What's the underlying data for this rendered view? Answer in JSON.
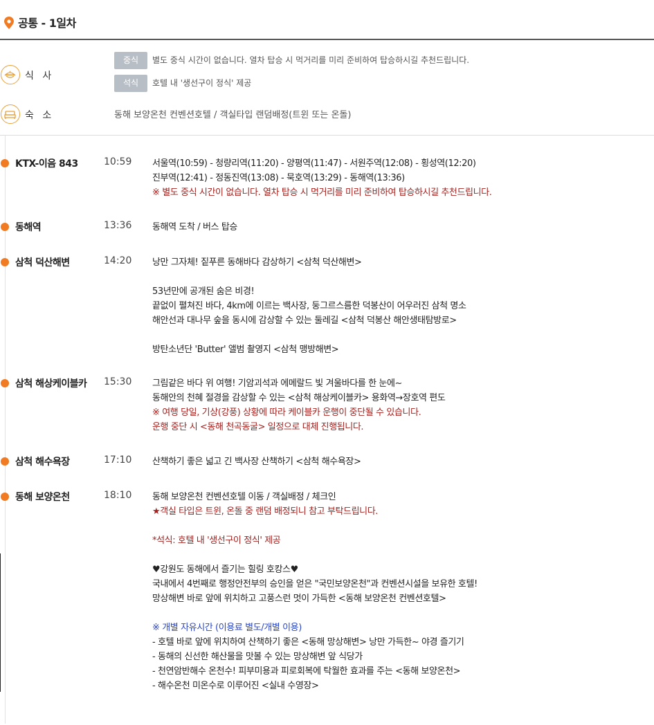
{
  "header": {
    "title": "공통 - 1일차",
    "accent": "#f07b22"
  },
  "info": {
    "meal_label": "식 사",
    "lunch_tag": "중식",
    "lunch_text": "별도 중식 시간이 없습니다. 열차 탑승 시 먹거리를 미리 준비하여 탑승하시길 추천드립니다.",
    "dinner_tag": "석식",
    "dinner_text": "호텔 내 '생선구이 정식' 제공",
    "lodging_label": "숙 소",
    "lodging_text": "동해 보양온천 컨벤션호텔 / 객실타입 랜덤배정(트윈 또는 온돌)"
  },
  "schedule": [
    {
      "place": "KTX-이음 843",
      "time": "10:59",
      "lines": [
        "서울역(10:59) - 청량리역(11:20) - 양평역(11:47) - 서원주역(12:08) - 횡성역(12:20)",
        "진부역(12:41) - 정동진역(13:08) - 묵호역(13:29) - 동해역(13:36)",
        "※ 별도 중식 시간이 없습니다. 열차 탑승 시 먹거리를 미리 준비하여 탑승하시길 추천드립니다."
      ]
    },
    {
      "place": "동해역",
      "time": "13:36",
      "lines": [
        "동해역 도착 / 버스 탑승"
      ]
    },
    {
      "place": "삼척 덕산해변",
      "time": "14:20",
      "lines": [
        "낭만 그자체! 짙푸른 동해바다 감상하기 <삼척 덕산해변>",
        "",
        "53년만에 공개된 숨은 비경!",
        "끝없이 펼쳐진 바다, 4km에 이르는 백사장, 둥그르스름한 덕봉산이 어우러진 삼척 명소",
        "해안선과 대나무 숲을 동시에 감상할 수 있는 둘레길 <삼척 덕봉산 해안생태탐방로>",
        "",
        "방탄소년단 'Butter' 앨범 촬영지 <삼척 맹방해변>"
      ]
    },
    {
      "place": "삼척 해상케이블카",
      "time": "15:30",
      "lines": [
        "그림같은 바다 위 여행! 기암괴석과 에메랄드 빛 겨울바다를 한 눈에~",
        "동해안의 천혜 절경을 감상할 수 있는 <삼척 해상케이블카> 용화역→장호역 편도",
        "※ 여행 당일, 기상(강풍) 상황에 따라 케이블카 운행이 중단될 수 있습니다.",
        "운행 중단 시 <동해 천곡동굴> 일정으로 대체 진행됩니다."
      ]
    },
    {
      "place": "삼척 해수욕장",
      "time": "17:10",
      "lines": [
        "산책하기 좋은 넓고 긴 백사장 산책하기 <삼척 해수욕장>"
      ]
    },
    {
      "place": "동해 보양온천",
      "time": "18:10",
      "lines": [
        "동해 보양온천 컨벤션호텔 이동 / 객실배정 / 체크인",
        "★객실 타입은 트윈, 온돌 중 랜덤 배정되니 참고 부탁드립니다.",
        "",
        "*석식: 호텔 내 '생선구이 정식' 제공",
        "",
        "♥강원도 동해에서 즐기는 힐링 호캉스♥",
        "국내에서 4번째로 행정안전부의 승인을 얻은 \"국민보양온천\"과 컨벤션시설을 보유한 호텔!",
        "망상해변 바로 앞에 위치하고 고풍스런 멋이 가득한 <동해 보양온천 컨벤션호텔>",
        "",
        "※ 개별 자유시간 (이용료 별도/개별 이용)",
        "- 호텔 바로 앞에 위치하여 산책하기 좋은 <동해 망상해변> 낭만 가득한~ 야경 즐기기",
        "- 동해의 신선한 해산물을 맛볼 수 있는 망상해변 앞 식당가",
        "- 천연암반해수 온천수! 피부미용과 피로회복에 탁월한 효과를 주는 <동해 보양온천>",
        "- 해수온천 미온수로 이루어진 <실내 수영장>"
      ]
    }
  ]
}
